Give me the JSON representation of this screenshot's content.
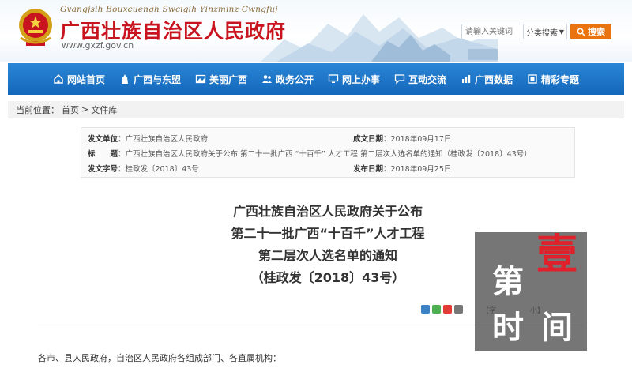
{
  "header": {
    "pinyin": "Gvangjsih Bouxcuengh Swcigih Yinzminz Cwngfuj",
    "title": "广西壮族自治区人民政府",
    "url": "www.gxzf.gov.cn"
  },
  "search": {
    "placeholder": "请输入关键词",
    "category": "分类搜索",
    "button": "搜索"
  },
  "nav": {
    "items": [
      {
        "label": "网站首页",
        "icon": "home-icon"
      },
      {
        "label": "广西与东盟",
        "icon": "tower-icon"
      },
      {
        "label": "美丽广西",
        "icon": "landscape-icon"
      },
      {
        "label": "政务公开",
        "icon": "people-icon"
      },
      {
        "label": "网上办事",
        "icon": "monitor-icon"
      },
      {
        "label": "互动交流",
        "icon": "chat-icon"
      },
      {
        "label": "广西数据",
        "icon": "bar-chart-icon"
      },
      {
        "label": "精彩专题",
        "icon": "album-icon"
      }
    ]
  },
  "breadcrumb": {
    "prefix": "当前位置：",
    "home": "首页",
    "sep": ">",
    "current": "文件库"
  },
  "info": {
    "issuer_label": "发文单位：",
    "issuer": "广西壮族自治区人民政府",
    "date_label": "成文日期：",
    "date": "2018年09月17日",
    "title_label": "标　　题：",
    "title": "广西壮族自治区人民政府关于公布 第二十一批广西 “十百千” 人才工程 第二层次人选名单的通知（桂政发〔2018〕43号）",
    "docno_label": "发文字号：",
    "docno": "桂政发〔2018〕43号",
    "pub_label": "发布日期：",
    "pub_date": "2018年09月25日"
  },
  "doc": {
    "line1": "广西壮族自治区人民政府关于公布",
    "line2": "第二十一批广西“十百千”人才工程",
    "line3": "第二层次人选名单的通知",
    "line4": "（桂政发〔2018〕43号）",
    "greeting": "各市、县人民政府，自治区人民政府各组成部门、各直属机构："
  },
  "font_size": {
    "open": "【字",
    "small": "小】"
  },
  "watermark": {
    "di": "第",
    "yi": "壹",
    "shi": "时",
    "jian": "间"
  },
  "colors": {
    "brand_red": "#c8141e",
    "nav_blue": "#1a6fc4",
    "search_orange": "#e8730f"
  }
}
